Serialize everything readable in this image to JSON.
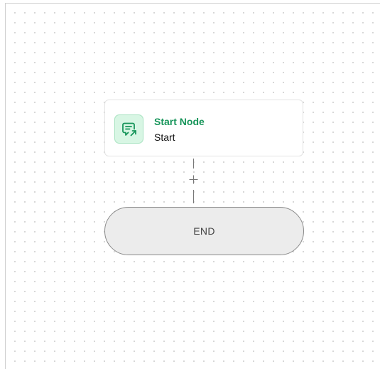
{
  "canvas": {
    "background": "#ffffff",
    "dot_color": "#d4d4d4"
  },
  "start_node": {
    "title": "Start Node",
    "subtitle": "Start",
    "icon": "chat-share-icon",
    "accent_color": "#17955a",
    "icon_background": "#d8f6e4"
  },
  "add_step": {
    "icon": "plus-icon"
  },
  "end_node": {
    "label": "END",
    "background": "#ececec"
  }
}
